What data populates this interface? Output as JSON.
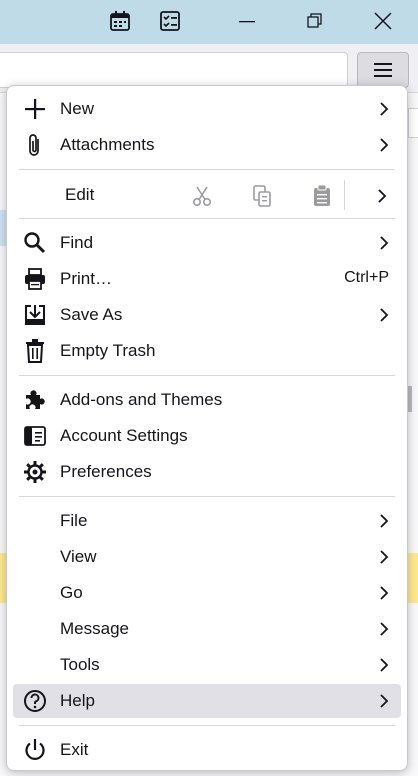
{
  "window": {
    "buttons": [
      "calendar-icon",
      "tasks-icon",
      "minimize-icon",
      "restore-icon",
      "close-icon"
    ]
  },
  "menu": {
    "group1": [
      {
        "label": "New",
        "icon": "plus-icon",
        "submenu": true
      },
      {
        "label": "Attachments",
        "icon": "paperclip-icon",
        "submenu": true
      }
    ],
    "edit": {
      "label": "Edit",
      "buttons": [
        "cut-icon",
        "copy-icon",
        "paste-icon"
      ]
    },
    "group2": [
      {
        "label": "Find",
        "icon": "search-icon",
        "submenu": true
      },
      {
        "label": "Print…",
        "icon": "printer-icon",
        "shortcut": "Ctrl+P"
      },
      {
        "label": "Save As",
        "icon": "save-as-icon",
        "submenu": true
      },
      {
        "label": "Empty Trash",
        "icon": "trash-icon"
      }
    ],
    "group3": [
      {
        "label": "Add-ons and Themes",
        "icon": "puzzle-icon"
      },
      {
        "label": "Account Settings",
        "icon": "account-settings-icon"
      },
      {
        "label": "Preferences",
        "icon": "gear-icon"
      }
    ],
    "group4": [
      {
        "label": "File",
        "submenu": true
      },
      {
        "label": "View",
        "submenu": true
      },
      {
        "label": "Go",
        "submenu": true
      },
      {
        "label": "Message",
        "submenu": true
      },
      {
        "label": "Tools",
        "submenu": true
      },
      {
        "label": "Help",
        "icon": "help-icon",
        "submenu": true,
        "hovered": true
      }
    ],
    "exit": {
      "label": "Exit",
      "icon": "power-icon"
    }
  },
  "colors": {
    "titlebar": "#bfdbe8",
    "hover": "#e0e0e6",
    "separator": "#d7d7db"
  }
}
